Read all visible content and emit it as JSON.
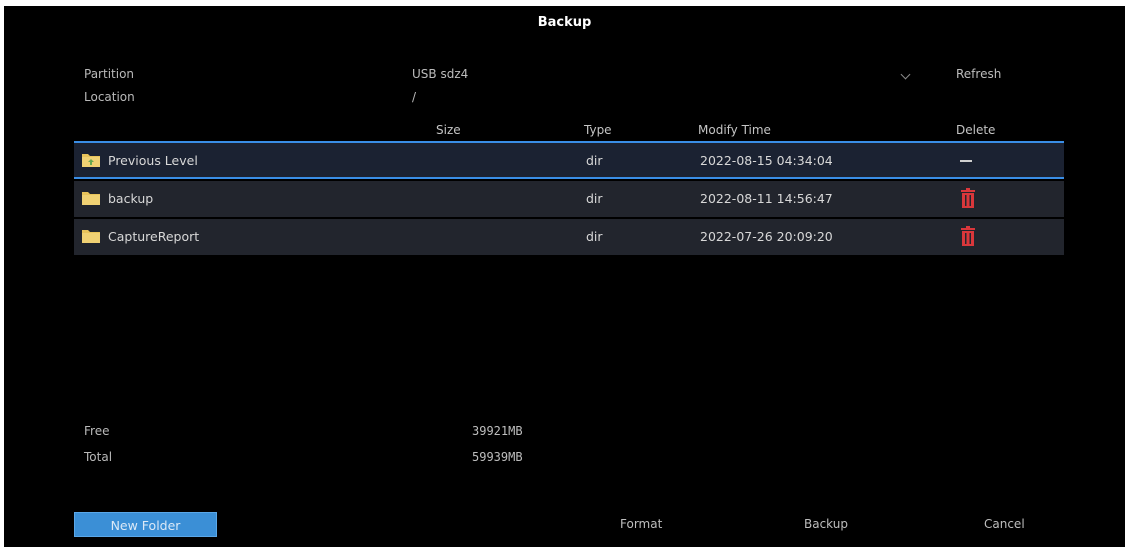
{
  "dialog": {
    "title": "Backup"
  },
  "partition": {
    "label": "Partition",
    "value": "USB sdz4",
    "refresh_label": "Refresh"
  },
  "location": {
    "label": "Location",
    "value": "/"
  },
  "table": {
    "columns": {
      "size": "Size",
      "type": "Type",
      "modify_time": "Modify Time",
      "delete": "Delete"
    },
    "rows": [
      {
        "name": "Previous Level",
        "size": "",
        "type": "dir",
        "modify_time": "2022-08-15 04:34:04",
        "delete": "dash"
      },
      {
        "name": "backup",
        "size": "",
        "type": "dir",
        "modify_time": "2022-08-11 14:56:47",
        "delete": "trash-icon"
      },
      {
        "name": "CaptureReport",
        "size": "",
        "type": "dir",
        "modify_time": "2022-07-26 20:09:20",
        "delete": "trash-icon"
      }
    ]
  },
  "storage": {
    "free_label": "Free",
    "free_value": "39921MB",
    "total_label": "Total",
    "total_value": "59939MB"
  },
  "buttons": {
    "new_folder": "New Folder",
    "format": "Format",
    "backup": "Backup",
    "cancel": "Cancel"
  },
  "colors": {
    "background": "#000000",
    "row": "#22252d",
    "selection_border": "#3a8ee6",
    "primary_button": "#3b8fd6",
    "delete_icon": "#d9373b",
    "folder_icon": "#e8c35a"
  }
}
